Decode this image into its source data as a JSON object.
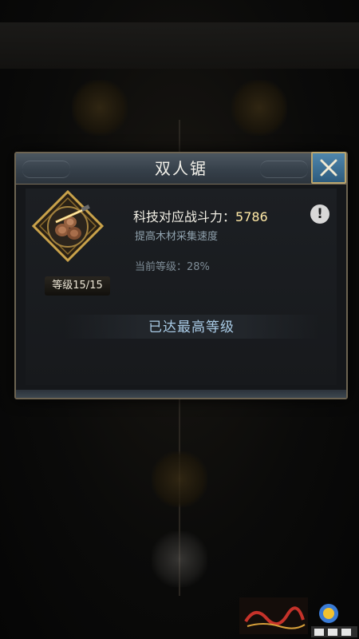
{
  "dialog": {
    "title": "双人锯",
    "close_icon": "close-x-icon"
  },
  "item": {
    "icon": "saw-and-logs-icon",
    "level_label": "等级15/15"
  },
  "info": {
    "power_label": "科技对应战斗力：",
    "power_value": "5786",
    "description": "提高木材采集速度",
    "current_level": "当前等级：28%",
    "info_icon_glyph": "!"
  },
  "status": {
    "max_level_text": "已达最高等级"
  },
  "colors": {
    "title_bar": "#36404a",
    "close_button": "#3d7399",
    "power_value": "#ffe9a6",
    "max_level_text": "#a9cbe6",
    "badge_gold": "#c9a24a"
  }
}
